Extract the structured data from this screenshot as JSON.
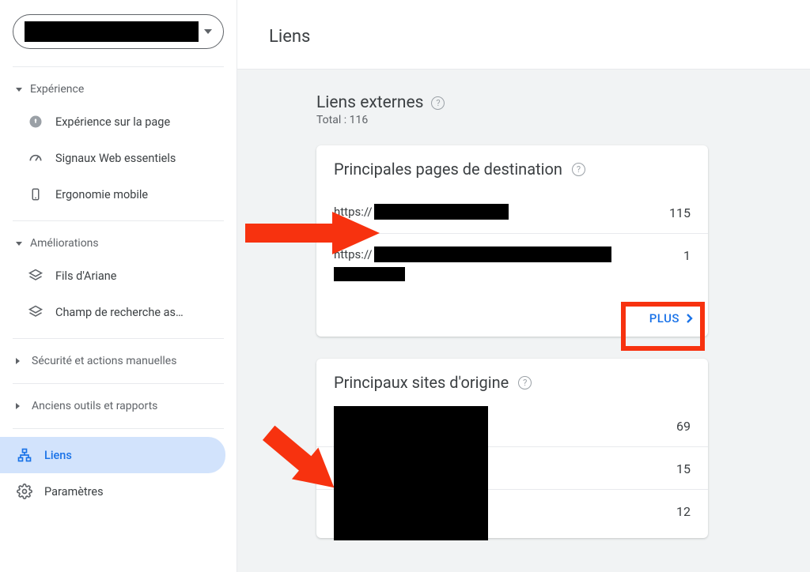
{
  "sidebar": {
    "sections": {
      "experience": {
        "label": "Expérience",
        "items": [
          {
            "label": "Expérience sur la page"
          },
          {
            "label": "Signaux Web essentiels"
          },
          {
            "label": "Ergonomie mobile"
          }
        ]
      },
      "improvements": {
        "label": "Améliorations",
        "items": [
          {
            "label": "Fils d'Ariane"
          },
          {
            "label": "Champ de recherche as…"
          }
        ]
      },
      "security": {
        "label": "Sécurité et actions manuelles"
      },
      "legacy": {
        "label": "Anciens outils et rapports"
      }
    },
    "links_label": "Liens",
    "settings_label": "Paramètres"
  },
  "page": {
    "title": "Liens",
    "external": {
      "heading": "Liens externes",
      "total_label": "Total : 116"
    },
    "cards": {
      "top_pages": {
        "title": "Principales pages de destination",
        "rows": [
          {
            "prefix": "https://",
            "value": "115"
          },
          {
            "prefix": "https://",
            "value": "1"
          }
        ],
        "more": "PLUS"
      },
      "top_sites": {
        "title": "Principaux sites d'origine",
        "rows": [
          {
            "value": "69"
          },
          {
            "value": "15"
          },
          {
            "value": "12"
          }
        ]
      }
    }
  }
}
